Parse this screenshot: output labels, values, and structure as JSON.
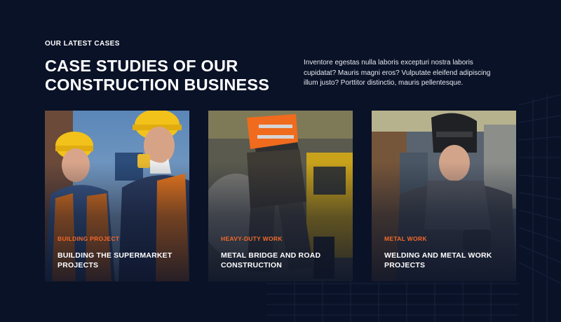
{
  "section": {
    "eyebrow": "OUR LATEST CASES",
    "heading_line1": "CASE STUDIES OF OUR",
    "heading_line2": "CONSTRUCTION BUSINESS",
    "intro_line1": "Inventore egestas nulla laboris excepturi nostra laboris",
    "intro_line2": "cupidatat? Mauris magni eros? Vulputate eleifend adipiscing",
    "intro_line3": "illum justo? Porttitor distinctio, mauris pellentesque."
  },
  "cases": [
    {
      "category": "BUILDING PROJECT",
      "title_line1": "BUILDING THE SUPERMARKET",
      "title_line2": "PROJECTS",
      "image": "workers-in-hard-hats-image"
    },
    {
      "category": "HEAVY-DUTY WORK",
      "title_line1": "METAL BRIDGE AND ROAD",
      "title_line2": "CONSTRUCTION",
      "image": "worker-with-jackhammer-image"
    },
    {
      "category": "METAL WORK",
      "title_line1": "WELDING AND METAL WORK",
      "title_line2": "PROJECTS",
      "image": "welder-in-mask-image"
    }
  ],
  "colors": {
    "background": "#0a1227",
    "accent": "#f26a2b",
    "text": "#ffffff"
  }
}
